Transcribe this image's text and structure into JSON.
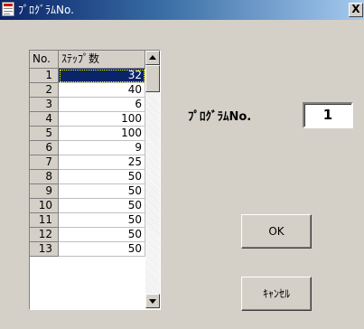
{
  "window": {
    "title": "ﾌﾟﾛｸﾞﾗﾑNo.",
    "close_label": "X"
  },
  "grid": {
    "headers": {
      "no": "No.",
      "steps": "ｽﾃｯﾌﾟ数"
    },
    "selected_row": 1,
    "rows": [
      {
        "no": "1",
        "steps": "32"
      },
      {
        "no": "2",
        "steps": "40"
      },
      {
        "no": "3",
        "steps": "6"
      },
      {
        "no": "4",
        "steps": "100"
      },
      {
        "no": "5",
        "steps": "100"
      },
      {
        "no": "6",
        "steps": "9"
      },
      {
        "no": "7",
        "steps": "25"
      },
      {
        "no": "8",
        "steps": "50"
      },
      {
        "no": "9",
        "steps": "50"
      },
      {
        "no": "10",
        "steps": "50"
      },
      {
        "no": "11",
        "steps": "50"
      },
      {
        "no": "12",
        "steps": "50"
      },
      {
        "no": "13",
        "steps": "50"
      }
    ]
  },
  "program": {
    "label": "ﾌﾟﾛｸﾞﾗﾑNo.",
    "value": "1"
  },
  "buttons": {
    "ok": "OK",
    "cancel": "ｷｬﾝｾﾙ"
  },
  "colors": {
    "selection": "#0a246a",
    "window_face": "#d4d0c8"
  }
}
